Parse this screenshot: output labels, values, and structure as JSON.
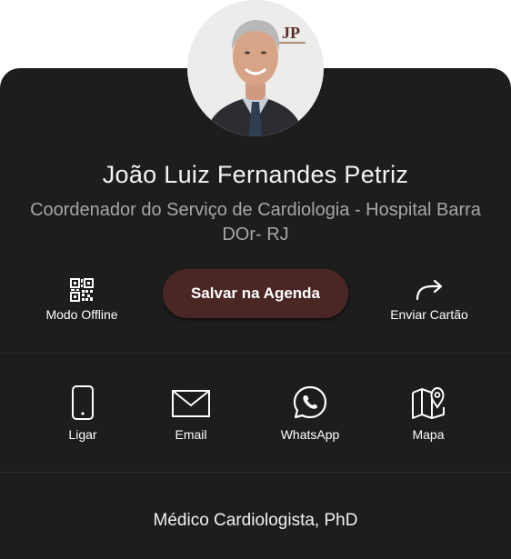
{
  "profile": {
    "name": "João Luiz Fernandes Petriz",
    "subtitle": "Coordenador do Serviço de Cardiologia - Hospital Barra DOr- RJ",
    "avatar_logo": "JP",
    "specialty": "Médico Cardiologista, PhD"
  },
  "actions": {
    "offline_label": "Modo Offline",
    "offline_icon": "qr-code-icon",
    "save_label": "Salvar na Agenda",
    "share_label": "Enviar Cartão",
    "share_icon": "share-arrow-icon"
  },
  "contacts": [
    {
      "label": "Ligar",
      "icon": "phone-icon"
    },
    {
      "label": "Email",
      "icon": "email-icon"
    },
    {
      "label": "WhatsApp",
      "icon": "whatsapp-icon"
    },
    {
      "label": "Mapa",
      "icon": "map-pin-icon"
    }
  ],
  "colors": {
    "card_background": "#1e1d1d",
    "save_button": "#4a2725",
    "logo_accent": "#5a2b25"
  }
}
